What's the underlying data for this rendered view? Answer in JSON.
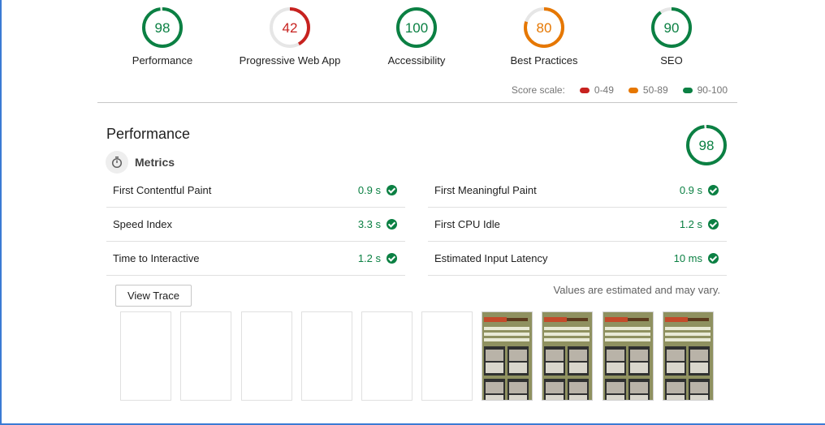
{
  "colors": {
    "pass": "#0b8043",
    "average": "#e67700",
    "fail": "#c7221f",
    "track": "#e6e6e6"
  },
  "gauges": [
    {
      "label": "Performance",
      "score": "98",
      "value": 98,
      "status": "pass"
    },
    {
      "label": "Progressive Web App",
      "score": "42",
      "value": 42,
      "status": "fail"
    },
    {
      "label": "Accessibility",
      "score": "100",
      "value": 100,
      "status": "pass"
    },
    {
      "label": "Best Practices",
      "score": "80",
      "value": 80,
      "status": "average"
    },
    {
      "label": "SEO",
      "score": "90",
      "value": 90,
      "status": "pass"
    }
  ],
  "scale": {
    "label": "Score scale:",
    "items": [
      {
        "label": "0-49",
        "status": "fail"
      },
      {
        "label": "50-89",
        "status": "average"
      },
      {
        "label": "90-100",
        "status": "pass"
      }
    ]
  },
  "section": {
    "title": "Performance",
    "score": "98",
    "value": 98,
    "metrics_title": "Metrics",
    "metrics_icon": "stopwatch-icon"
  },
  "metrics": [
    {
      "label": "First Contentful Paint",
      "value": "0.9 s"
    },
    {
      "label": "First Meaningful Paint",
      "value": "0.9 s"
    },
    {
      "label": "Speed Index",
      "value": "3.3 s"
    },
    {
      "label": "First CPU Idle",
      "value": "1.2 s"
    },
    {
      "label": "Time to Interactive",
      "value": "1.2 s"
    },
    {
      "label": "Estimated Input Latency",
      "value": "10 ms"
    }
  ],
  "view_trace_label": "View Trace",
  "estimate_note": "Values are estimated and may vary.",
  "filmstrip": {
    "frames": [
      "blank",
      "blank",
      "blank",
      "blank",
      "blank",
      "blank",
      "loaded",
      "loaded",
      "loaded",
      "loaded"
    ]
  }
}
